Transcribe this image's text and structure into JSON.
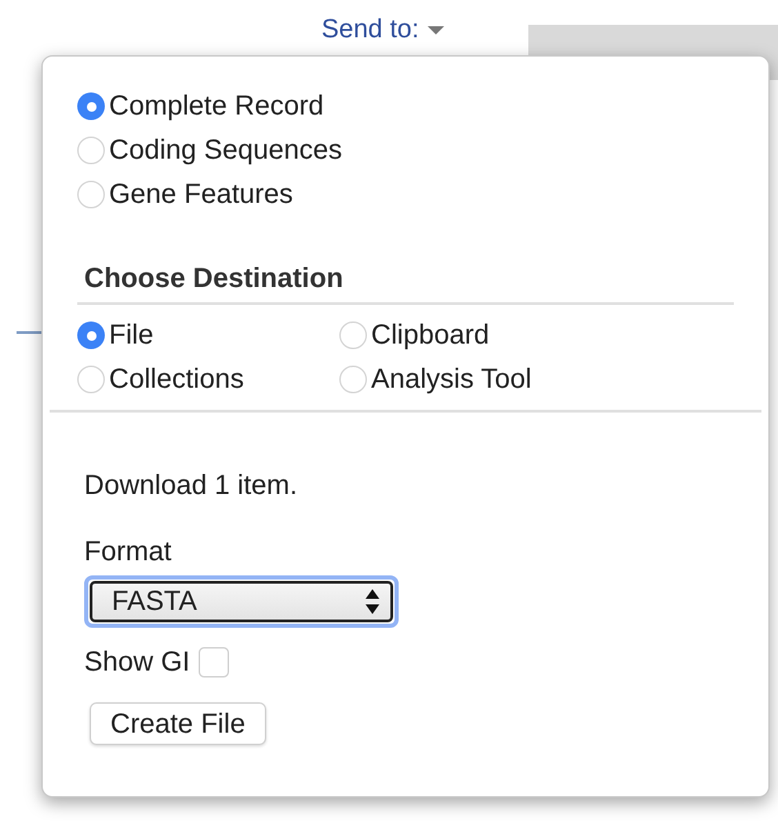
{
  "send_to": {
    "label": "Send to:"
  },
  "popup": {
    "record_options": [
      {
        "label": "Complete Record",
        "selected": true
      },
      {
        "label": "Coding Sequences",
        "selected": false
      },
      {
        "label": "Gene Features",
        "selected": false
      }
    ],
    "destination_heading": "Choose Destination",
    "destinations": [
      {
        "label": "File",
        "selected": true
      },
      {
        "label": "Clipboard",
        "selected": false
      },
      {
        "label": "Collections",
        "selected": false
      },
      {
        "label": "Analysis Tool",
        "selected": false
      }
    ],
    "download_text": "Download 1 item.",
    "format_label": "Format",
    "format_value": "FASTA",
    "show_gi": {
      "label": "Show GI",
      "checked": false
    },
    "create_button": "Create File"
  }
}
